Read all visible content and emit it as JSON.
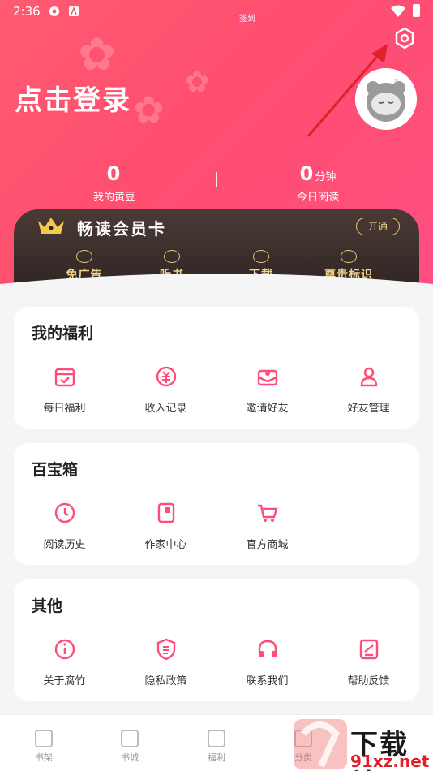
{
  "status_bar": {
    "time": "2:36"
  },
  "header": {
    "login_text": "点击登录",
    "stats": [
      {
        "value": "0",
        "unit": "",
        "label": "我的黄豆"
      },
      {
        "value": "0",
        "unit": "分钟",
        "label": "今日阅读"
      }
    ]
  },
  "vip": {
    "title": "畅读会员卡",
    "open_label": "开通",
    "features": [
      "免广告",
      "听书",
      "下载",
      "尊贵标识"
    ]
  },
  "sections": {
    "welfare": {
      "title": "我的福利",
      "items": [
        "每日福利",
        "收入记录",
        "邀请好友",
        "好友管理"
      ]
    },
    "toolbox": {
      "title": "百宝箱",
      "items": [
        "阅读历史",
        "作家中心",
        "官方商城"
      ]
    },
    "other": {
      "title": "其他",
      "items": [
        "关于腐竹",
        "隐私政策",
        "联系我们",
        "帮助反馈"
      ]
    }
  },
  "tabbar": {
    "tabs": [
      "书架",
      "书城",
      "福利",
      "分类"
    ],
    "badge": "签到"
  },
  "watermark": {
    "text": "下载站",
    "url": "91xz.net"
  },
  "colors": {
    "accent": "#ff4d7a",
    "vip_gold": "#f2d38a"
  }
}
